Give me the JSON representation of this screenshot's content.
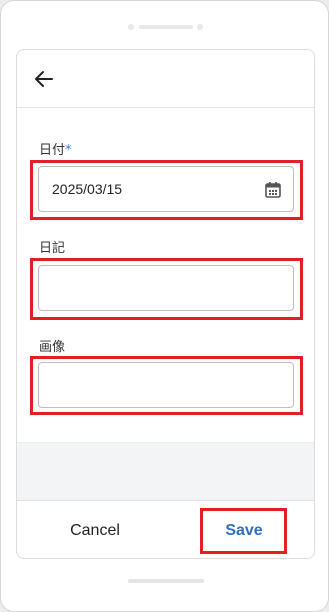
{
  "toolbar": {
    "back_icon": "arrow-left-icon"
  },
  "form": {
    "date": {
      "label": "日付",
      "required_mark": "*",
      "value": "2025/03/15",
      "icon": "calendar-icon"
    },
    "diary": {
      "label": "日記",
      "value": ""
    },
    "image": {
      "label": "画像",
      "value": ""
    }
  },
  "actions": {
    "cancel_label": "Cancel",
    "save_label": "Save"
  },
  "colors": {
    "accent": "#2f6fc0",
    "highlight": "#e31e24",
    "required": "#3b7bd4"
  }
}
